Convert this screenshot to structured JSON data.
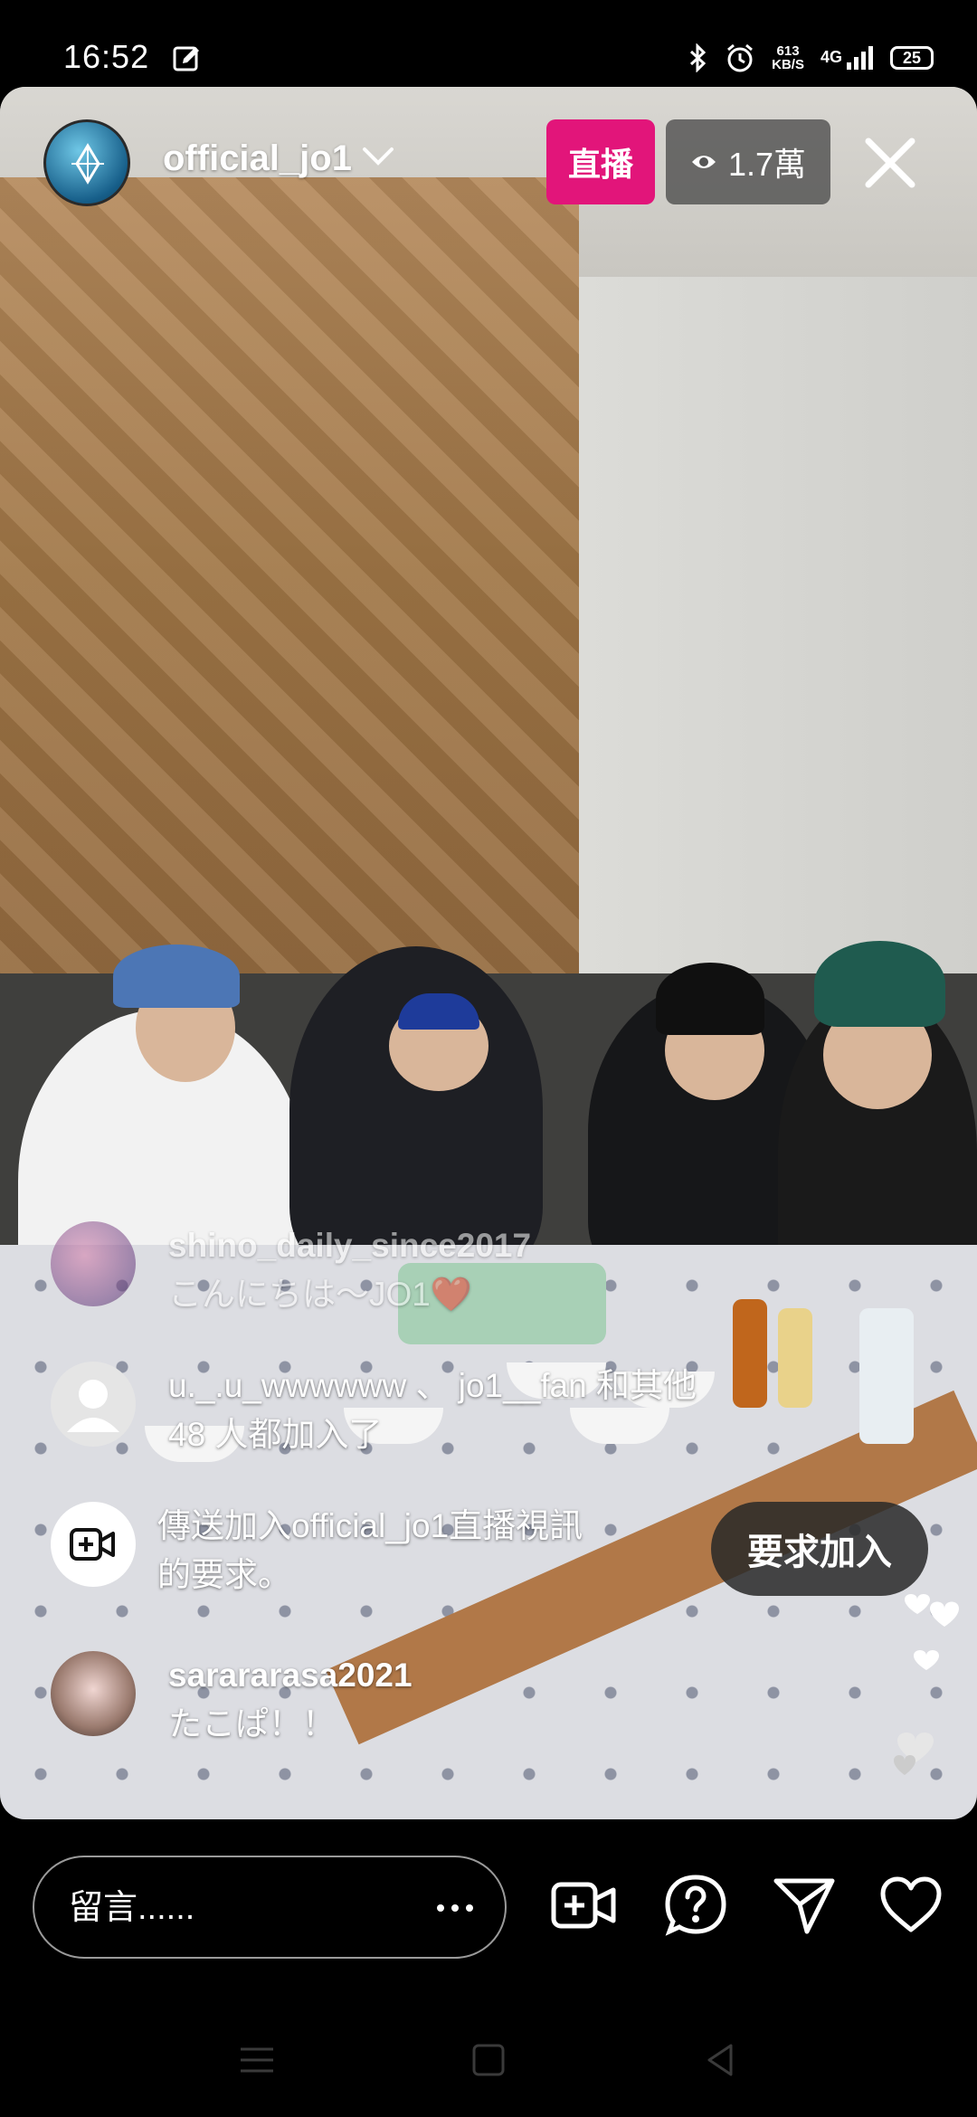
{
  "status_bar": {
    "time": "16:52",
    "speed_value": "613",
    "speed_unit": "KB/S",
    "network": "4G",
    "battery": "25"
  },
  "live_header": {
    "username": "official_jo1",
    "live_label": "直播",
    "viewer_count": "1.7萬"
  },
  "comments": [
    {
      "user": "shino_daily_since2017",
      "text": "こんにちは〜JO1❤️",
      "faded": true
    },
    {
      "type": "join",
      "text_line1": "u._.u_wwwwww 、 jo1__fan 和其他",
      "text_line2": "48 人都加入了"
    },
    {
      "type": "request",
      "text_line1": "傳送加入official_jo1直播視訊",
      "text_line2": "的要求。"
    },
    {
      "user": "sarararasa2021",
      "text": "たこぱ！！"
    }
  ],
  "request_button": "要求加入",
  "comment_box": {
    "placeholder": "留言......"
  },
  "actions": [
    "add-video-icon",
    "question-icon",
    "send-icon",
    "heart-icon"
  ],
  "colors": {
    "live_badge": "#e2157a",
    "background": "#000000"
  }
}
